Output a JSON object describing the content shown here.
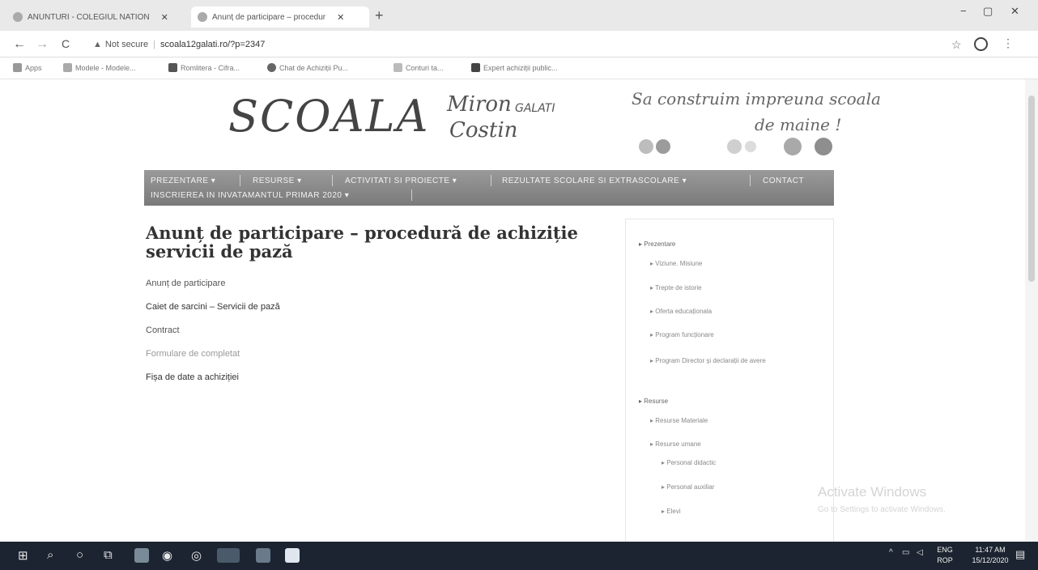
{
  "browser": {
    "tabs": [
      {
        "title": "ANUNTURI - COLEGIUL NATION"
      },
      {
        "title": "Anunț de participare – procedur"
      }
    ],
    "new_tab": "+",
    "window_controls": {
      "minimize": "−",
      "restore": "▢",
      "close": "✕"
    },
    "nav": {
      "back": "←",
      "forward": "→",
      "reload": "C"
    },
    "address": {
      "security_label": "Not secure",
      "url": "scoala12galati.ro/?p=2347"
    },
    "bookmarks": [
      "Apps",
      "Modele - Modele...",
      "Romlitera - Cifra...",
      "Chat de Achiziții Pu...",
      "Conturi ta...",
      "Expert achiziții public..."
    ]
  },
  "site": {
    "logo": {
      "scoala": "SCOALA",
      "miron": "Miron",
      "galati": "GALATI",
      "costin": "Costin"
    },
    "tagline": {
      "line1": "Sa construim impreuna scoala",
      "line2": "de maine !"
    },
    "nav": [
      "PREZENTARE ▾",
      "RESURSE ▾",
      "ACTIVITATI SI PROIECTE ▾",
      "REZULTATE SCOLARE SI EXTRASCOLARE ▾",
      "CONTACT",
      "INSCRIEREA IN INVATAMANTUL PRIMAR 2020 ▾"
    ]
  },
  "article": {
    "title": "Anunț de participare – procedură de achiziție servicii de pază",
    "documents": [
      "Anunț de participare",
      "Caiet de sarcini – Servicii de pază",
      "Contract",
      "Formulare de completat",
      "Fișa de date a achiziției"
    ]
  },
  "sidebar": {
    "items": [
      "Prezentare",
      "Viziune. Misiune",
      "Trepte de istorie",
      "Oferta educaționala",
      "Program funcționare",
      "Program Director și declarații de avere",
      "Resurse",
      "Resurse Materiale",
      "Resurse umane",
      "Personal didactic",
      "Personal auxiliar",
      "Elevi"
    ]
  },
  "watermark": {
    "line1": "Activate Windows",
    "line2": "Go to Settings to activate Windows."
  },
  "taskbar": {
    "language": "ENG",
    "layout": "ROP",
    "time": "11:47 AM",
    "date": "15/12/2020"
  },
  "colors": {
    "nav_bg": "#8a8a8a",
    "taskbar_bg": "#1b2430",
    "tabbar_bg": "#e9e9e9"
  }
}
